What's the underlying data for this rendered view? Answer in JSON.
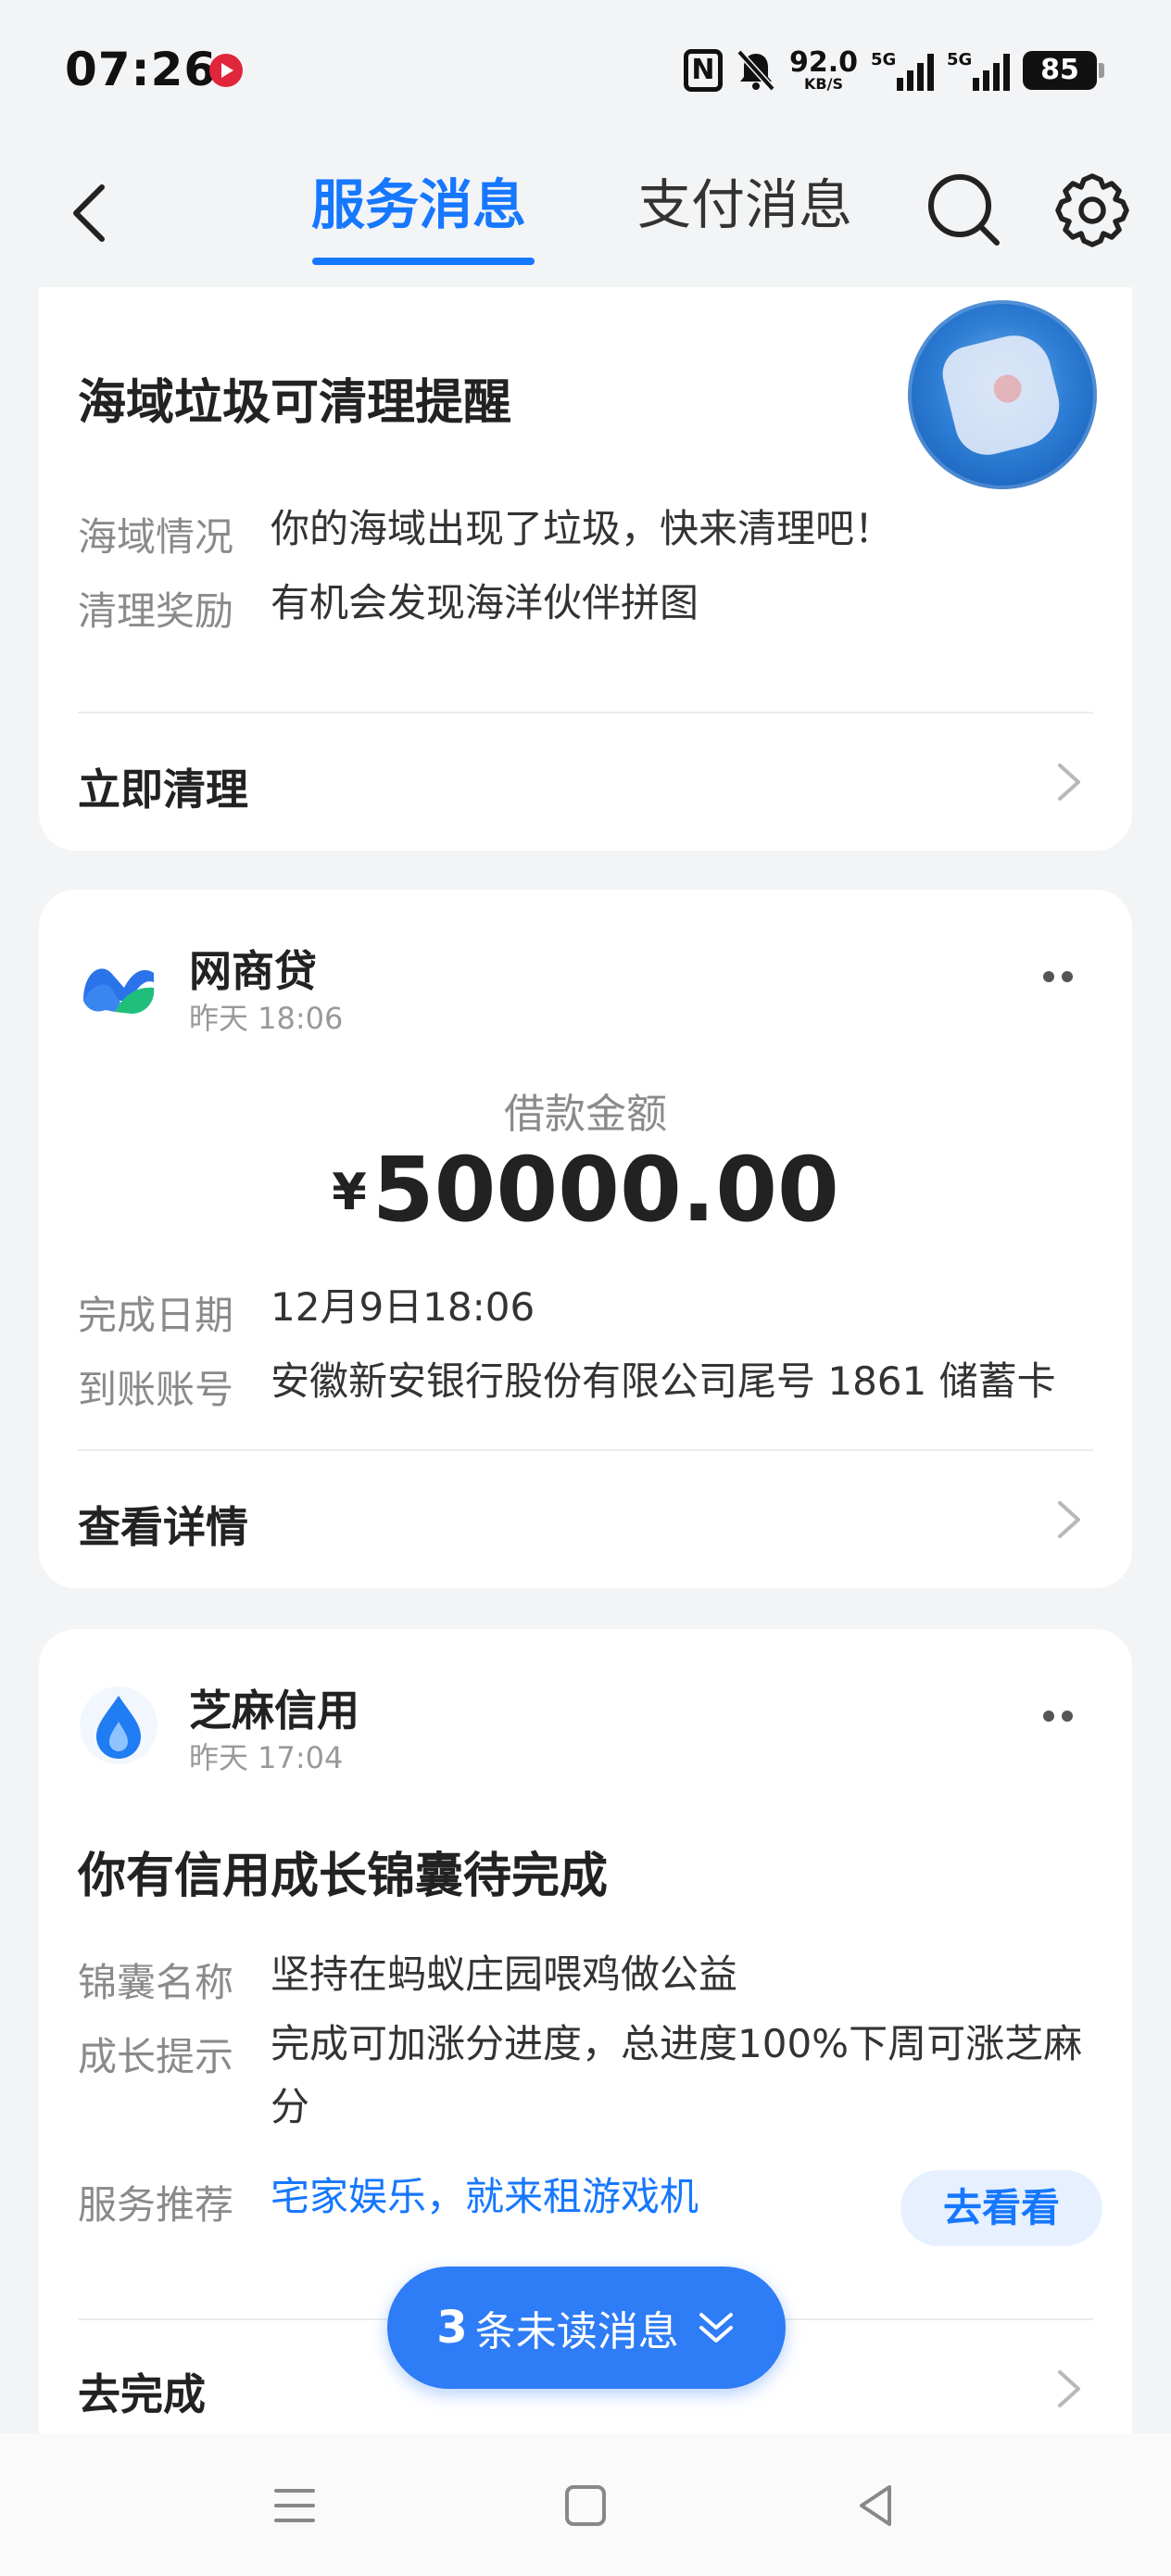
{
  "status_bar": {
    "time": "07:26",
    "nfc": "N",
    "net_speed": "92.0",
    "net_unit": "KB/S",
    "signal1_label": "5G",
    "signal2_label": "5G",
    "battery": "85"
  },
  "header": {
    "tabs": [
      {
        "label": "服务消息",
        "active": true
      },
      {
        "label": "支付消息",
        "active": false
      }
    ],
    "accent_color": "#1677ff"
  },
  "card_ocean": {
    "title": "海域垃圾可清理提醒",
    "rows": [
      {
        "key": "海域情况",
        "value": "你的海域出现了垃圾，快来清理吧！"
      },
      {
        "key": "清理奖励",
        "value": "有机会发现海洋伙伴拼图"
      }
    ],
    "action": "立即清理"
  },
  "card_loan": {
    "app_name": "网商贷",
    "time": "昨天 18:06",
    "amount_label": "借款金额",
    "currency": "¥",
    "amount": "50000.00",
    "rows": [
      {
        "key": "完成日期",
        "value": "12月9日18:06"
      },
      {
        "key": "到账账号",
        "value": "安徽新安银行股份有限公司尾号 1861 储蓄卡"
      }
    ],
    "action": "查看详情"
  },
  "card_credit": {
    "app_name": "芝麻信用",
    "time": "昨天 17:04",
    "title": "你有信用成长锦囊待完成",
    "rows": [
      {
        "key": "锦囊名称",
        "value": "坚持在蚂蚁庄园喂鸡做公益"
      },
      {
        "key": "成长提示",
        "value": "完成可加涨分进度，总进度100%下周可涨芝麻分"
      },
      {
        "key": "服务推荐",
        "value": "宅家娱乐，就来租游戏机"
      }
    ],
    "button": "去看看",
    "action": "去完成"
  },
  "unread": {
    "count": "3",
    "text": "条未读消息"
  }
}
